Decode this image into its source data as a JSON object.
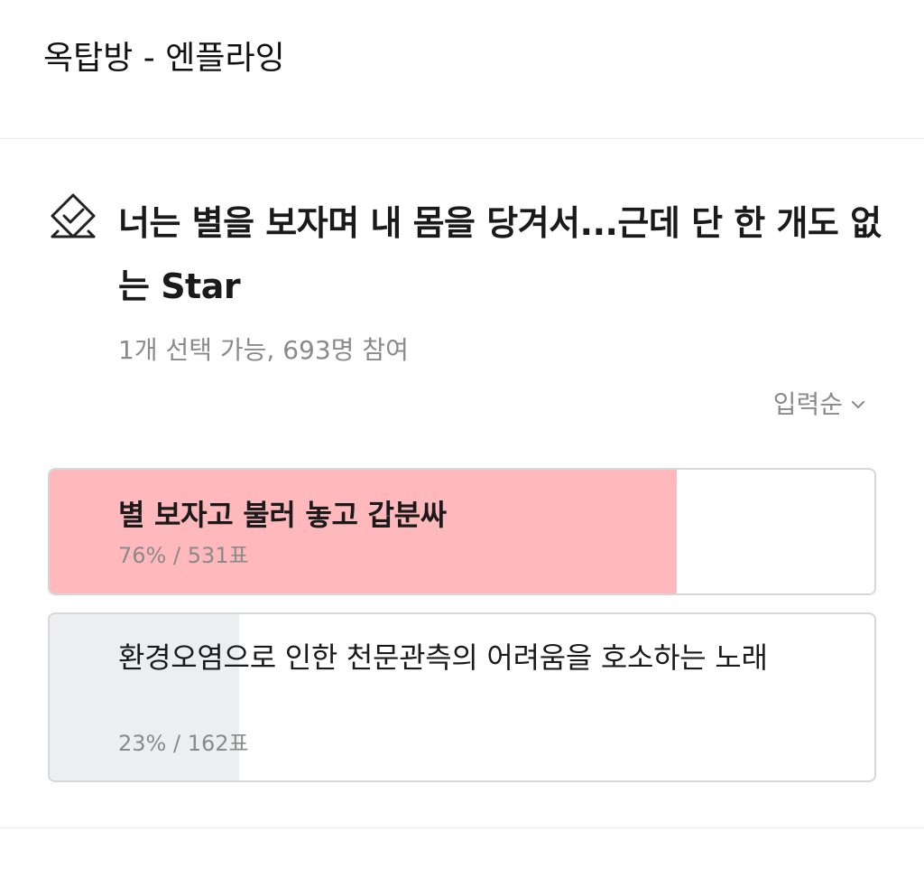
{
  "header": {
    "title": "옥탑방 - 엔플라잉"
  },
  "poll": {
    "question": "너는 별을 보자며 내 몸을 당겨서...근데 단 한 개도 없는 Star",
    "meta": "1개 선택 가능, 693명 참여",
    "sort_label": "입력순",
    "icon": "vote-check-icon",
    "options": [
      {
        "label": "별 보자고 불러 놓고 갑분싸",
        "stat": "76% / 531표",
        "percent": 76,
        "votes": 531,
        "selected": true,
        "fill_color": "#ffb8bb"
      },
      {
        "label": "환경오염으로 인한 천문관측의 어려움을 호소하는 노래",
        "stat": "23% / 162표",
        "percent": 23,
        "votes": 162,
        "selected": false,
        "fill_color": "#edeef0"
      }
    ]
  },
  "colors": {
    "text_primary": "#1a1a1a",
    "text_secondary": "#8a8a8a",
    "border": "#d7d7d7",
    "divider": "#ebebeb"
  }
}
